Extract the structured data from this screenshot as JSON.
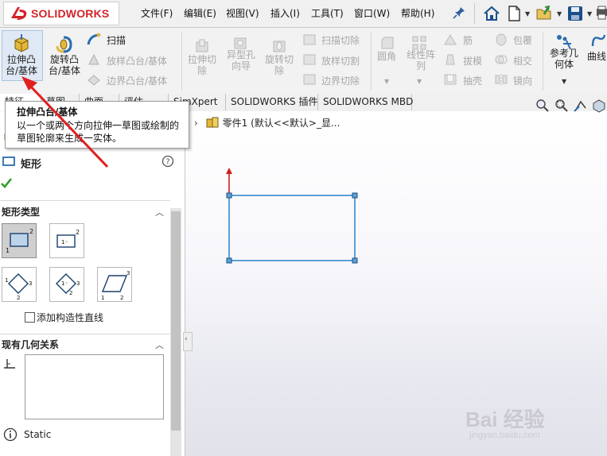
{
  "app": {
    "brand": "SOLIDWORKS",
    "brand_color": "#d2232a",
    "menus": [
      "文件(F)",
      "编辑(E)",
      "视图(V)",
      "插入(I)",
      "工具(T)",
      "窗口(W)",
      "帮助(H)"
    ]
  },
  "ribbon": {
    "extrude": {
      "line1": "拉伸凸",
      "line2": "台/基体"
    },
    "revolve": {
      "line1": "旋转凸",
      "line2": "台/基体"
    },
    "sweep": "扫描",
    "loft": "放样凸台/基体",
    "boundary": "边界凸台/基体",
    "extrude_cut": {
      "line1": "拉伸切",
      "line2": "除"
    },
    "hole_wizard": {
      "line1": "异型孔",
      "line2": "向导"
    },
    "revolve_cut": {
      "line1": "旋转切",
      "line2": "除"
    },
    "swept_cut": "扫描切除",
    "lofted_cut": "放样切割",
    "boundary_cut": "边界切除",
    "fillet": "圆角",
    "linear_pattern": {
      "line1": "线性阵",
      "line2": "列"
    },
    "rib": "筋",
    "draft": "拔模",
    "shell": "抽壳",
    "wrap": "包覆",
    "intersect": "相交",
    "mirror": "镜向",
    "ref_geometry": {
      "line1": "参考几",
      "line2": "何体"
    },
    "curves": "曲线"
  },
  "tabs": [
    "特征",
    "草图",
    "曲面",
    "评估",
    "SimXpert",
    "SOLIDWORKS 插件",
    "SOLIDWORKS MBD"
  ],
  "tooltip": {
    "title": "拉伸凸台/基体",
    "body": "以一个或两个方向拉伸一草图或绘制的草图轮廓来生成一实体。"
  },
  "breadcrumb": "零件1  (默认<<默认>_显...",
  "property_manager": {
    "title": "矩形",
    "rect_type_header": "矩形类型",
    "construction_label": "添加构造性直线",
    "relations_header": "现有几何关系",
    "status": "Static"
  },
  "watermark": {
    "main": "Bai 经验",
    "sub": "jingyan.baidu.com"
  },
  "colors": {
    "sketch_line": "#5aa0d6",
    "axis_red": "#cc1f1f",
    "accept_green": "#2f9e2f",
    "annotation_arrow": "#e02020"
  }
}
